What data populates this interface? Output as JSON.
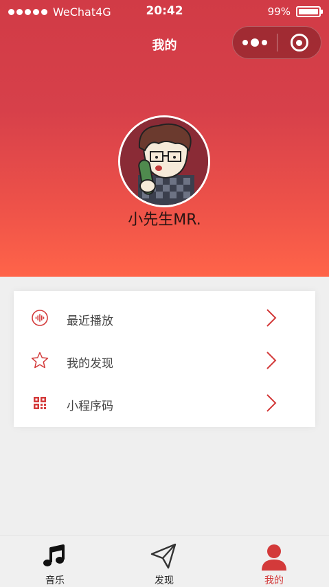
{
  "status_bar": {
    "carrier": "WeChat4G",
    "time": "20:42",
    "battery": "99%",
    "battery_level": 0.99
  },
  "nav": {
    "title": "我的"
  },
  "profile": {
    "username": "小先生MR."
  },
  "menu": {
    "items": [
      {
        "label": "最近播放",
        "icon": "audio-wave-icon"
      },
      {
        "label": "我的发现",
        "icon": "star-icon"
      },
      {
        "label": "小程序码",
        "icon": "qr-code-icon"
      }
    ]
  },
  "tabs": [
    {
      "label": "音乐",
      "icon": "music-note-icon",
      "active": false
    },
    {
      "label": "发现",
      "icon": "paper-plane-icon",
      "active": false
    },
    {
      "label": "我的",
      "icon": "user-icon",
      "active": true
    }
  ],
  "colors": {
    "accent": "#d33a3a",
    "header_top": "#d13b46",
    "header_bottom": "#ff6449",
    "background": "#efefef"
  }
}
